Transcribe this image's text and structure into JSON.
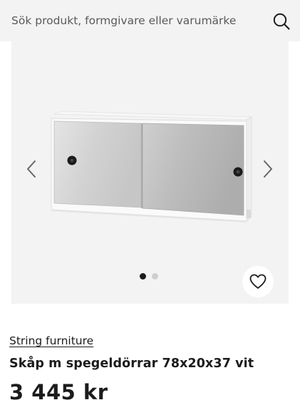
{
  "search": {
    "placeholder": "Sök produkt, formgivare eller varumärke",
    "button_icon": "search-icon"
  },
  "gallery": {
    "prev_icon": "chevron-left-icon",
    "next_icon": "chevron-right-icon",
    "image_count": 2,
    "active_index": 0,
    "favorite_icon": "heart-icon"
  },
  "product": {
    "brand": "String furniture",
    "title": "Skåp m spegeldörrar 78x20x37 vit",
    "price": "3 445 kr"
  },
  "colors": {
    "background": "#ffffff",
    "panel": "#f3f3f3",
    "text": "#1c1c1c",
    "dot_active": "#1c1c1c",
    "dot_inactive": "#cfcfcf"
  }
}
